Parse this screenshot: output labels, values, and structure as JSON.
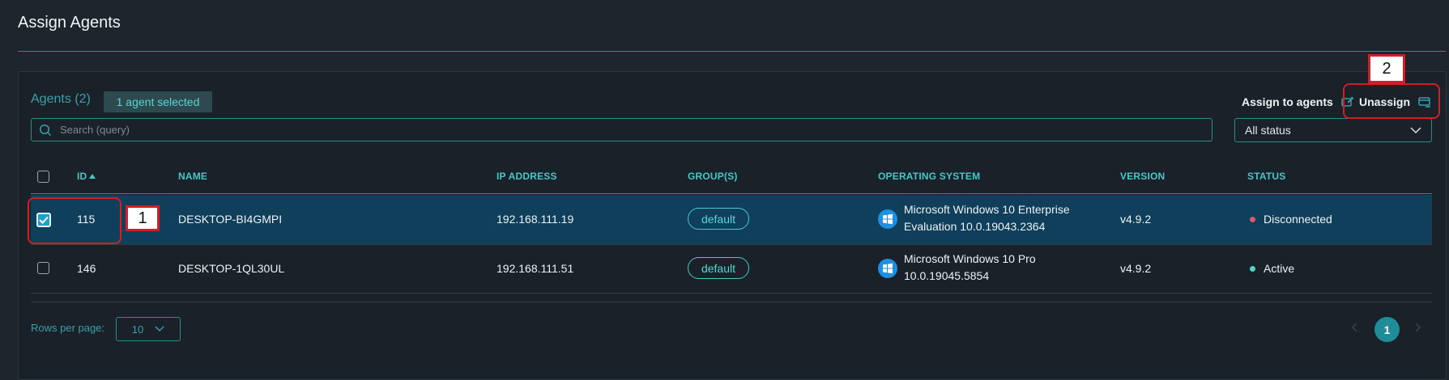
{
  "page": {
    "title": "Assign Agents"
  },
  "toolbar": {
    "agents_count_label": "Agents (2)",
    "selected_label": "1 agent selected",
    "assign_label": "Assign to agents",
    "unassign_label": "Unassign"
  },
  "search": {
    "placeholder": "Search (query)",
    "value": ""
  },
  "status_filter": {
    "selected": "All status"
  },
  "table": {
    "headers": {
      "id": "ID",
      "name": "NAME",
      "ip": "IP ADDRESS",
      "groups": "GROUP(S)",
      "os": "OPERATING SYSTEM",
      "version": "VERSION",
      "status": "STATUS"
    },
    "sort": {
      "column": "ID",
      "direction": "ascending"
    },
    "rows": [
      {
        "selected": true,
        "id": "115",
        "name": "DESKTOP-BI4GMPI",
        "ip": "192.168.111.19",
        "group": "default",
        "os_line1": "Microsoft Windows 10 Enterprise",
        "os_line2": "Evaluation 10.0.19043.2364",
        "os_icon": "windows-icon",
        "version": "v4.9.2",
        "status": "Disconnected",
        "status_color": "#e0566b"
      },
      {
        "selected": false,
        "id": "146",
        "name": "DESKTOP-1QL30UL",
        "ip": "192.168.111.51",
        "group": "default",
        "os_line1": "Microsoft Windows 10 Pro",
        "os_line2": "10.0.19045.5854",
        "os_icon": "windows-icon",
        "version": "v4.9.2",
        "status": "Active",
        "status_color": "#56d2c9"
      }
    ]
  },
  "pagination": {
    "rows_per_page_label": "Rows per page:",
    "rows_per_page_value": "10",
    "current_page": "1",
    "prev_icon": "chevron-left-icon",
    "next_icon": "chevron-right-icon"
  },
  "annotations": {
    "callout_1": "1",
    "callout_2": "2"
  },
  "colors": {
    "accent": "#44c9c9",
    "selected_row": "#0f3f5a",
    "callout": "#d21f26",
    "background": "#1e252c"
  }
}
